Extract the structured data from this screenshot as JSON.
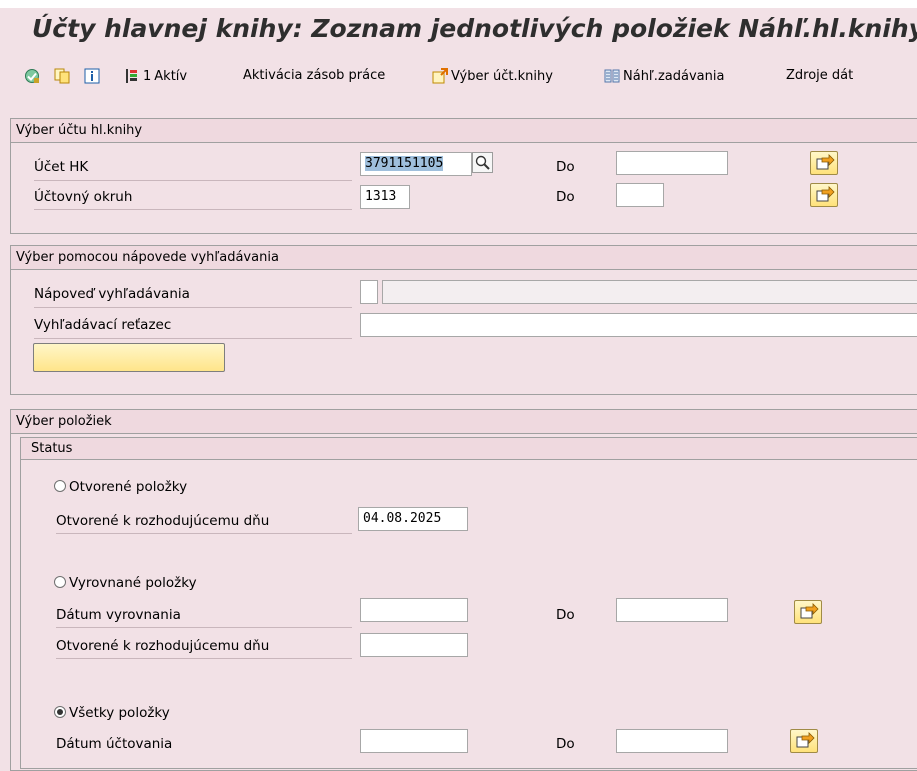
{
  "title": "Účty hlavnej knihy: Zoznam jednotlivých položiek Náhľ.hl.knihy",
  "toolbar": {
    "execute_icon": "execute-icon",
    "copy_icon": "copy-variant-icon",
    "info_icon": "info-icon",
    "active_count": "1",
    "active_label": "Aktív",
    "activate_label": "Aktivácia zásob práce",
    "select_account_label": "Výber účt.knihy",
    "entry_view_label": "Náhľ.zadávania",
    "data_sources_label": "Zdroje dát"
  },
  "account_section": {
    "header": "Výber účtu hl.knihy",
    "gl_account_label": "Účet HK",
    "gl_account_value": "3791151105",
    "company_code_label": "Účtovný okruh",
    "company_code_value": "1313",
    "to_label": "Do"
  },
  "search_section": {
    "header": "Výber pomocou nápovede vyhľadávania",
    "search_help_label": "Nápoveď vyhľadávania",
    "search_string_label": "Vyhľadávací reťazec"
  },
  "items_section": {
    "header": "Výber položiek",
    "status_header": "Status",
    "open_items_label": "Otvorené položky",
    "open_at_key_date_label": "Otvorené k rozhodujúcemu dňu",
    "open_key_date_value": "04.08.2025",
    "cleared_items_label": "Vyrovnané položky",
    "clearing_date_label": "Dátum vyrovnania",
    "cleared_open_key_date_label": "Otvorené k rozhodujúcemu dňu",
    "all_items_label": "Všetky položky",
    "posting_date_label": "Dátum účtovania",
    "to_label": "Do",
    "selected_status": "Všetky položky"
  }
}
